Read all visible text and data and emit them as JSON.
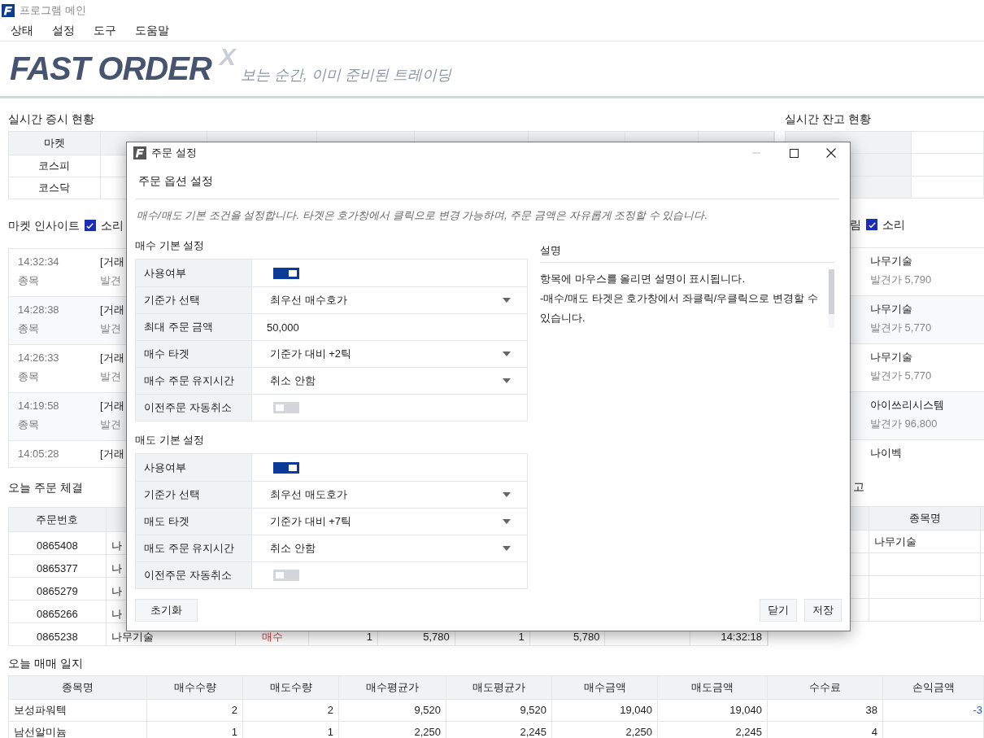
{
  "app": {
    "title": "프로그램 메인"
  },
  "menu": [
    "상태",
    "설정",
    "도구",
    "도움말"
  ],
  "banner": {
    "logo": "FAST ORDER",
    "mark": "X",
    "slogan": "보는 순간, 이미 준비된 트레이딩"
  },
  "market_status": {
    "title": "실시간 증시 현황",
    "columns": [
      "마켓"
    ],
    "rows": [
      "코스피",
      "코스닥"
    ]
  },
  "balance_status": {
    "title": "실시간 잔고 현황"
  },
  "market_insight": {
    "title": "마켓 인사이트",
    "sound": {
      "label": "소리",
      "checked": true
    },
    "items": [
      {
        "time": "14:32:34",
        "label": "종목",
        "headline": "[거래",
        "detail": "발견"
      },
      {
        "time": "14:28:38",
        "label": "종목",
        "headline": "[거래",
        "detail": "발견"
      },
      {
        "time": "14:26:33",
        "label": "종목",
        "headline": "[거래",
        "detail": "발견"
      },
      {
        "time": "14:19:58",
        "label": "종목",
        "headline": "[거래",
        "detail": "발견"
      },
      {
        "time": "14:05:28",
        "headline": "[거래"
      }
    ]
  },
  "alerts": {
    "title": "림",
    "sound": {
      "label": "소리",
      "checked": true
    },
    "items": [
      {
        "name": "나무기술",
        "price": "발견가 5,790"
      },
      {
        "name": "나무기술",
        "price": "발견가 5,770"
      },
      {
        "name": "나무기술",
        "price": "발견가 5,770"
      },
      {
        "name": "아이쓰리시스템",
        "price": "발견가 96,800"
      },
      {
        "name": "나이벡"
      }
    ]
  },
  "orders": {
    "title": "오늘 주문 체결",
    "columns": [
      "주문번호"
    ],
    "rows": [
      {
        "order_no": "0865408",
        "name": "나"
      },
      {
        "order_no": "0865377",
        "name": "나"
      },
      {
        "order_no": "0865279",
        "name": "나"
      },
      {
        "order_no": "0865266",
        "name": "나"
      },
      {
        "order_no": "0865238",
        "name": "나무기술",
        "side": "매수",
        "qty": "1",
        "price": "5,780",
        "filled_qty": "1",
        "filled_price": "5,780",
        "time": "14:32:18"
      }
    ]
  },
  "holdings": {
    "title": "고",
    "columns": [
      "종목명"
    ],
    "rows": [
      "나무기술"
    ]
  },
  "journal": {
    "title": "오늘 매매 일지",
    "columns": [
      "종목명",
      "매수수량",
      "매도수량",
      "매수평균가",
      "매도평균가",
      "매수금액",
      "매도금액",
      "수수료",
      "손익금액"
    ],
    "rows": [
      [
        "보성파워텍",
        "2",
        "2",
        "9,520",
        "9,520",
        "19,040",
        "19,040",
        "38",
        "-3"
      ],
      [
        "남선알미늄",
        "1",
        "1",
        "2,250",
        "2,245",
        "2,250",
        "2,245",
        "4"
      ]
    ]
  },
  "dialog": {
    "title": "주문 설정",
    "heading": "주문 옵션 설정",
    "description": "매수/매도 기본 조건을 설정합니다. 타겟은 호가창에서 클릭으로 변경 가능하며, 주문 금액은 자유롭게 조정할 수 있습니다.",
    "sections": [
      {
        "title": "매수 기본 설정",
        "rows": [
          {
            "label": "사용여부",
            "kind": "toggle",
            "on": true
          },
          {
            "label": "기준가 선택",
            "kind": "select",
            "value": "최우선 매수호가"
          },
          {
            "label": "최대 주문 금액",
            "kind": "input",
            "value": "50,000"
          },
          {
            "label": "매수 타겟",
            "kind": "select",
            "value": "기준가 대비 +2틱"
          },
          {
            "label": "매수 주문 유지시간",
            "kind": "select",
            "value": "취소 안함"
          },
          {
            "label": "이전주문 자동취소",
            "kind": "toggle",
            "on": false
          }
        ]
      },
      {
        "title": "매도 기본 설정",
        "rows": [
          {
            "label": "사용여부",
            "kind": "toggle",
            "on": true
          },
          {
            "label": "기준가 선택",
            "kind": "select",
            "value": "최우선 매도호가"
          },
          {
            "label": "매도 타겟",
            "kind": "select",
            "value": "기준가 대비 +7틱"
          },
          {
            "label": "매도 주문 유지시간",
            "kind": "select",
            "value": "취소 안함"
          },
          {
            "label": "이전주문 자동취소",
            "kind": "toggle",
            "on": false
          }
        ]
      }
    ],
    "help": {
      "title": "설명",
      "lines": [
        "항목에 마우스를 올리면 설명이 표시됩니다.",
        "-매수/매도 타겟은 호가창에서 좌클릭/우클릭으로 변경할 수 있습니다."
      ]
    },
    "buttons": {
      "reset": "초기화",
      "close": "닫기",
      "save": "저장"
    }
  }
}
